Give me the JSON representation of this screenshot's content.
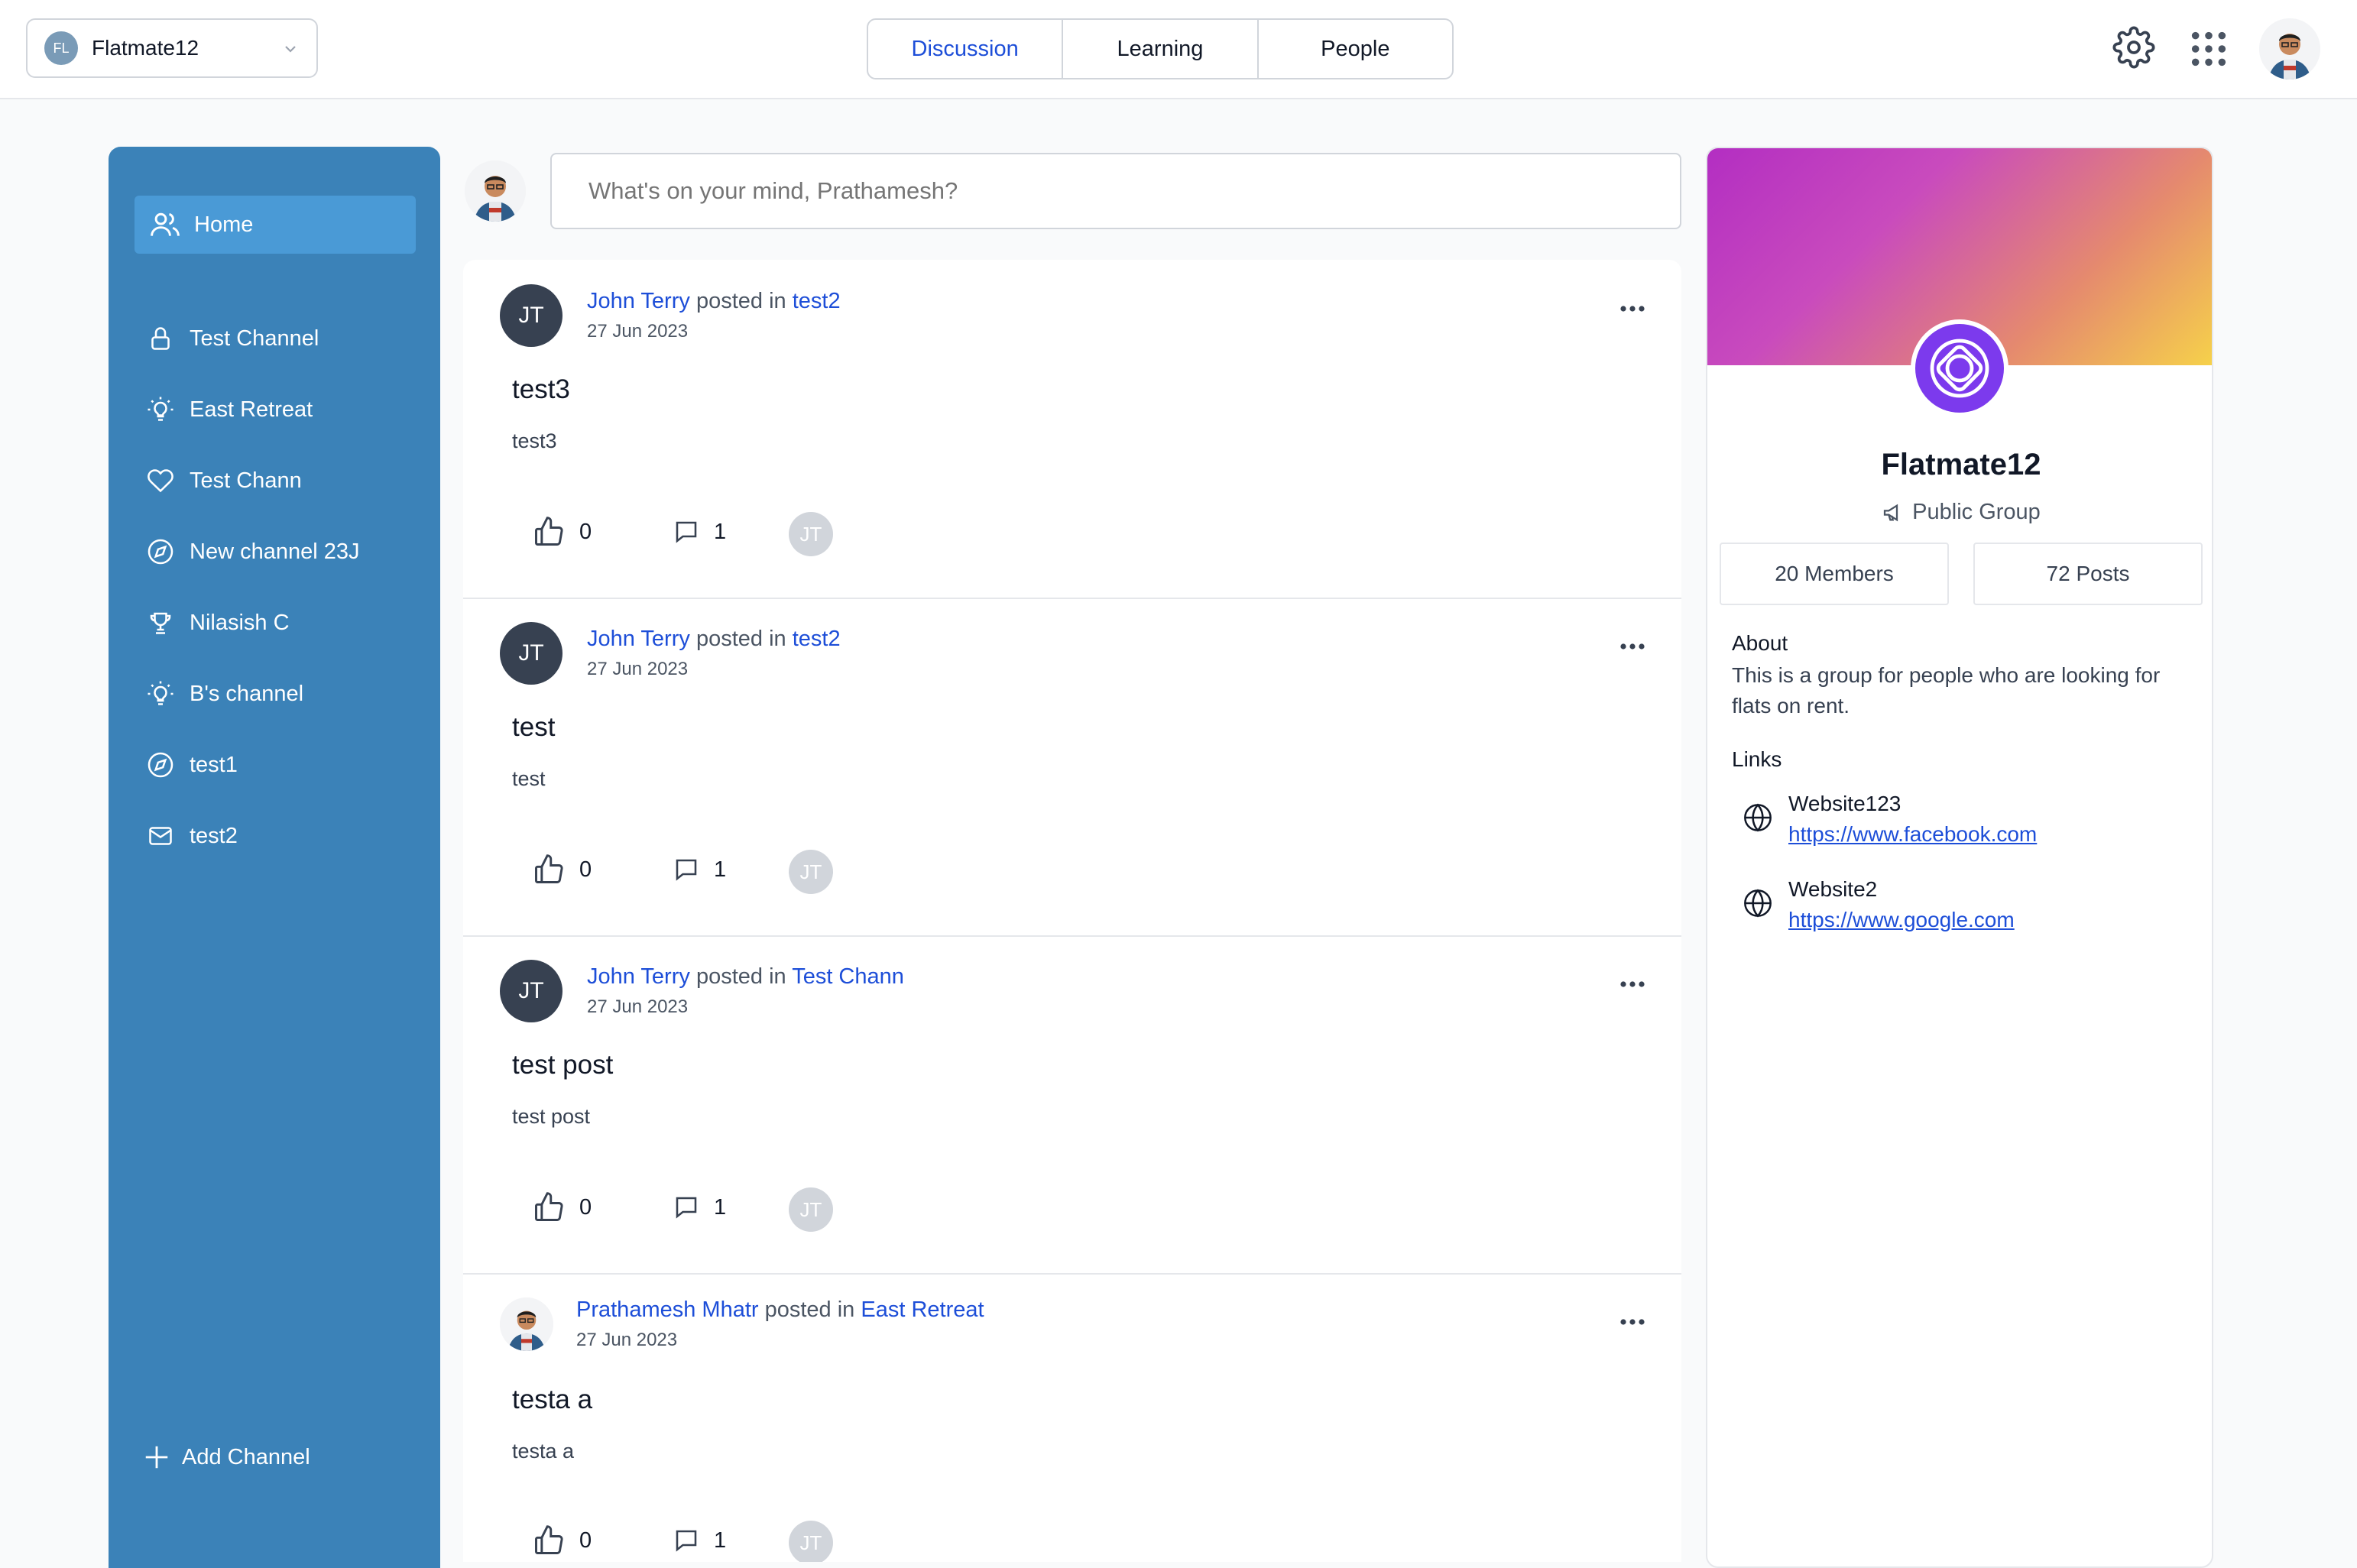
{
  "header": {
    "group_badge": "FL",
    "group_name": "Flatmate12",
    "tabs": [
      {
        "label": "Discussion",
        "active": true
      },
      {
        "label": "Learning",
        "active": false
      },
      {
        "label": "People",
        "active": false
      }
    ],
    "icons": [
      "gear-icon",
      "apps-grid-icon",
      "user-avatar"
    ]
  },
  "sidebar": {
    "home_label": "Home",
    "channels": [
      {
        "label": "Test Channel",
        "icon": "lock-icon"
      },
      {
        "label": "East Retreat",
        "icon": "bulb-icon"
      },
      {
        "label": "Test Chann",
        "icon": "heart-icon"
      },
      {
        "label": "New channel 23J",
        "icon": "compass-icon"
      },
      {
        "label": "Nilasish C",
        "icon": "trophy-icon"
      },
      {
        "label": "B's channel",
        "icon": "bulb-icon"
      },
      {
        "label": "test1",
        "icon": "compass-icon"
      },
      {
        "label": "test2",
        "icon": "mail-icon"
      }
    ],
    "add_channel_label": "Add Channel"
  },
  "composer": {
    "placeholder": "What's on your mind, Prathamesh?"
  },
  "posts": [
    {
      "initials": "JT",
      "author": "John Terry",
      "posted_in": "posted in",
      "channel": "test2",
      "date": "27 Jun 2023",
      "title": "test3",
      "body": "test3",
      "likes": "0",
      "comments": "1",
      "commenter": "JT"
    },
    {
      "initials": "JT",
      "author": "John Terry",
      "posted_in": "posted in",
      "channel": "test2",
      "date": "27 Jun 2023",
      "title": "test",
      "body": "test",
      "likes": "0",
      "comments": "1",
      "commenter": "JT"
    },
    {
      "initials": "JT",
      "author": "John Terry",
      "posted_in": "posted in",
      "channel": "Test Chann",
      "date": "27 Jun 2023",
      "title": "test post",
      "body": "test post",
      "likes": "0",
      "comments": "1",
      "commenter": "JT"
    },
    {
      "initials": "",
      "author": "Prathamesh Mhatr",
      "posted_in": "posted in",
      "channel": "East Retreat",
      "date": "27 Jun 2023",
      "title": "testa a",
      "body": "testa a",
      "likes": "0",
      "comments": "1",
      "commenter": "JT"
    }
  ],
  "group": {
    "name": "Flatmate12",
    "privacy": "Public Group",
    "members": "20 Members",
    "posts": "72 Posts",
    "about_heading": "About",
    "about_text": "This is a group for people who are looking for flats on rent.",
    "links_heading": "Links",
    "links": [
      {
        "name": "Website123",
        "url": "https://www.facebook.com"
      },
      {
        "name": "Website2",
        "url": "https://www.google.com"
      }
    ]
  },
  "colors": {
    "accent": "#1d4ed8",
    "sidebar": "#3b82b8",
    "sidebar_active": "#4a9ad6"
  }
}
